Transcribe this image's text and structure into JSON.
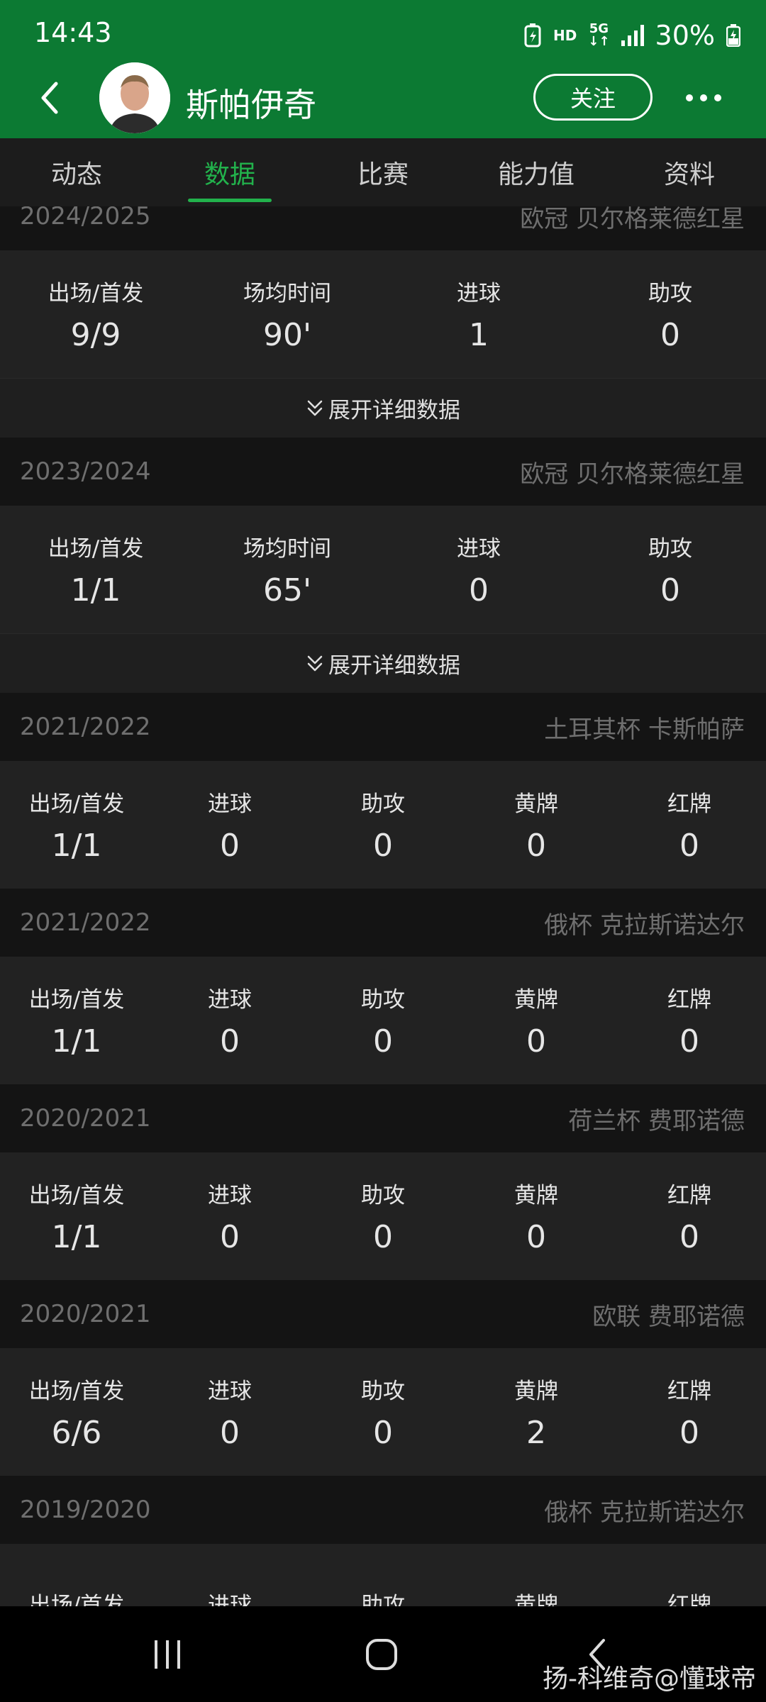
{
  "status_bar": {
    "time": "14:43",
    "hd": "HD",
    "network": "5G",
    "battery": "30%"
  },
  "header": {
    "player_name": "斯帕伊奇",
    "follow_label": "关注",
    "accent_color": "#0c7a33"
  },
  "tabs": [
    {
      "label": "动态",
      "active": false
    },
    {
      "label": "数据",
      "active": true
    },
    {
      "label": "比赛",
      "active": false
    },
    {
      "label": "能力值",
      "active": false
    },
    {
      "label": "资料",
      "active": false
    }
  ],
  "sections": [
    {
      "season": "2024/2025",
      "competition": "欧冠 贝尔格莱德红星",
      "stats": [
        {
          "label": "出场/首发",
          "value": "9/9"
        },
        {
          "label": "场均时间",
          "value": "90'"
        },
        {
          "label": "进球",
          "value": "1"
        },
        {
          "label": "助攻",
          "value": "0"
        }
      ],
      "expand_label": "展开详细数据"
    },
    {
      "season": "2023/2024",
      "competition": "欧冠 贝尔格莱德红星",
      "stats": [
        {
          "label": "出场/首发",
          "value": "1/1"
        },
        {
          "label": "场均时间",
          "value": "65'"
        },
        {
          "label": "进球",
          "value": "0"
        },
        {
          "label": "助攻",
          "value": "0"
        }
      ],
      "expand_label": "展开详细数据"
    },
    {
      "season": "2021/2022",
      "competition": "土耳其杯 卡斯帕萨",
      "stats": [
        {
          "label": "出场/首发",
          "value": "1/1"
        },
        {
          "label": "进球",
          "value": "0"
        },
        {
          "label": "助攻",
          "value": "0"
        },
        {
          "label": "黄牌",
          "value": "0"
        },
        {
          "label": "红牌",
          "value": "0"
        }
      ]
    },
    {
      "season": "2021/2022",
      "competition": "俄杯 克拉斯诺达尔",
      "stats": [
        {
          "label": "出场/首发",
          "value": "1/1"
        },
        {
          "label": "进球",
          "value": "0"
        },
        {
          "label": "助攻",
          "value": "0"
        },
        {
          "label": "黄牌",
          "value": "0"
        },
        {
          "label": "红牌",
          "value": "0"
        }
      ]
    },
    {
      "season": "2020/2021",
      "competition": "荷兰杯 费耶诺德",
      "stats": [
        {
          "label": "出场/首发",
          "value": "1/1"
        },
        {
          "label": "进球",
          "value": "0"
        },
        {
          "label": "助攻",
          "value": "0"
        },
        {
          "label": "黄牌",
          "value": "0"
        },
        {
          "label": "红牌",
          "value": "0"
        }
      ]
    },
    {
      "season": "2020/2021",
      "competition": "欧联 费耶诺德",
      "stats": [
        {
          "label": "出场/首发",
          "value": "6/6"
        },
        {
          "label": "进球",
          "value": "0"
        },
        {
          "label": "助攻",
          "value": "0"
        },
        {
          "label": "黄牌",
          "value": "2"
        },
        {
          "label": "红牌",
          "value": "0"
        }
      ]
    },
    {
      "season": "2019/2020",
      "competition": "俄杯 克拉斯诺达尔",
      "stats": [
        {
          "label": "出场/首发",
          "value": ""
        },
        {
          "label": "进球",
          "value": ""
        },
        {
          "label": "助攻",
          "value": ""
        },
        {
          "label": "黄牌",
          "value": ""
        },
        {
          "label": "红牌",
          "value": ""
        }
      ]
    }
  ],
  "watermark": "扬-科维奇@懂球帝"
}
